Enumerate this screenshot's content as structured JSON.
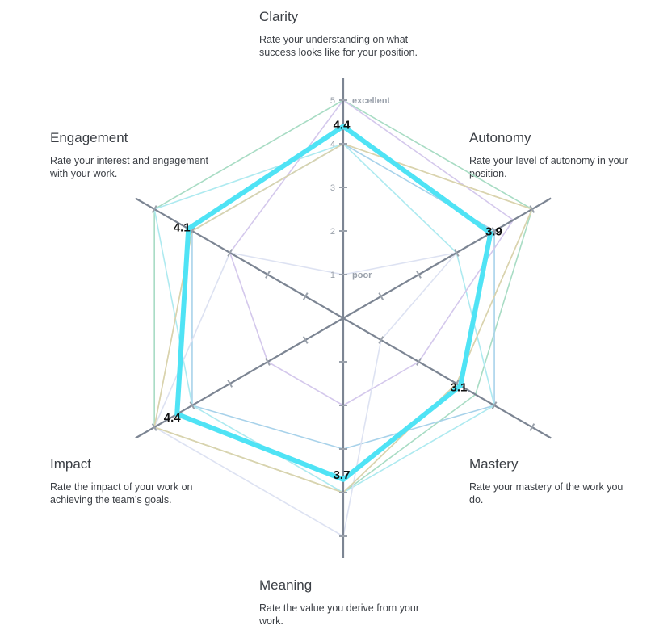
{
  "dimensions": [
    {
      "key": "clarity",
      "title": "Clarity",
      "description": "Rate your understanding on what success looks like for your position."
    },
    {
      "key": "autonomy",
      "title": "Autonomy",
      "description": "Rate your level of autonomy in your position."
    },
    {
      "key": "mastery",
      "title": "Mastery",
      "description": "Rate your mastery of the work you do."
    },
    {
      "key": "meaning",
      "title": "Meaning",
      "description": "Rate the value you derive from your work."
    },
    {
      "key": "impact",
      "title": "Impact",
      "description": "Rate the impact of your work on achieving the team’s goals."
    },
    {
      "key": "engagement",
      "title": "Engagement",
      "description": "Rate your interest and engagement with your work."
    }
  ],
  "chart_data": {
    "type": "radar",
    "axes": [
      "Clarity",
      "Autonomy",
      "Mastery",
      "Meaning",
      "Impact",
      "Engagement"
    ],
    "range": [
      0,
      5
    ],
    "scale_ticks": [
      "1",
      "2",
      "3",
      "4",
      "5"
    ],
    "scale_words": {
      "low": "poor",
      "high": "excellent"
    },
    "highlight": {
      "values": [
        4.4,
        3.9,
        3.1,
        3.7,
        4.4,
        4.1
      ],
      "labels": [
        "4.4",
        "3.9",
        "3.1",
        "3.7",
        "4.4",
        "4.1"
      ],
      "color": "#4fe3f5"
    },
    "series": [
      {
        "values": [
          5,
          5,
          3.5,
          4,
          5,
          5
        ],
        "color": "#a8dcc4"
      },
      {
        "values": [
          4,
          5,
          3,
          4,
          5,
          4
        ],
        "color": "#f2dc9c"
      },
      {
        "values": [
          4,
          4,
          4,
          3,
          4,
          4
        ],
        "color": "#a8d2ea"
      },
      {
        "values": [
          4,
          3,
          4,
          4,
          4,
          5
        ],
        "color": "#aeeaf0"
      },
      {
        "values": [
          5,
          4.5,
          2,
          2,
          2,
          3
        ],
        "color": "#d4c8ec"
      },
      {
        "values": [
          1,
          3,
          1,
          5,
          5,
          3
        ],
        "color": "#dde2f2"
      },
      {
        "values": [
          4,
          5,
          3,
          4,
          5,
          4
        ],
        "color": "#d8d3b0"
      }
    ]
  },
  "colors": {
    "axis": "#7c8593",
    "tick": "#9aa1ab",
    "text": "#3b3f45"
  }
}
